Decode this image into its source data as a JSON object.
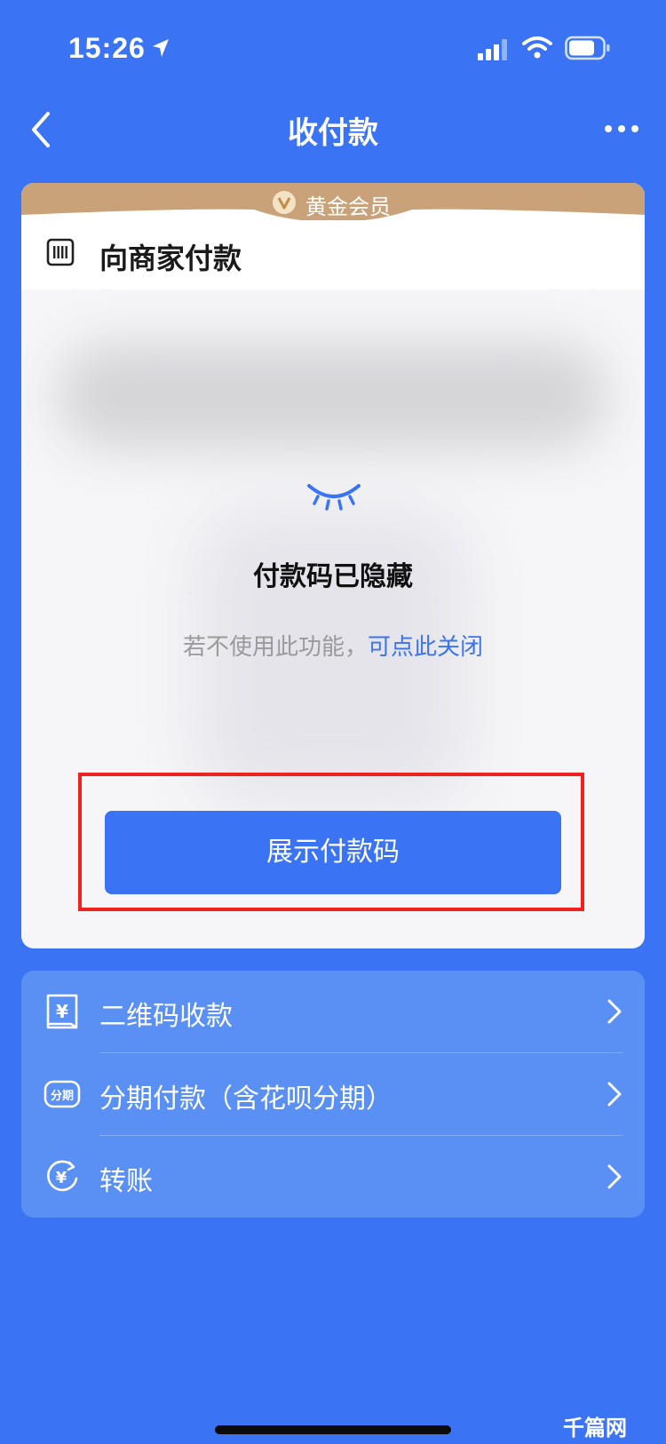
{
  "status_bar": {
    "time": "15:26"
  },
  "nav": {
    "title": "收付款"
  },
  "card": {
    "badge": "黄金会员",
    "merchant_title": "向商家付款",
    "hidden_title": "付款码已隐藏",
    "hint_prefix": "若不使用此功能，",
    "hint_link": "可点此关闭",
    "show_button": "展示付款码"
  },
  "menu": {
    "items": [
      {
        "label": "二维码收款",
        "icon": "qr-receive-icon"
      },
      {
        "label": "分期付款（含花呗分期）",
        "icon": "installment-icon",
        "icon_text": "分期"
      },
      {
        "label": "转账",
        "icon": "transfer-icon"
      }
    ]
  },
  "watermark": "千篇网",
  "colors": {
    "background": "#3a73f3",
    "gold": "#c9a27a",
    "menu": "#5a8ff3",
    "highlight": "#f0211e"
  }
}
